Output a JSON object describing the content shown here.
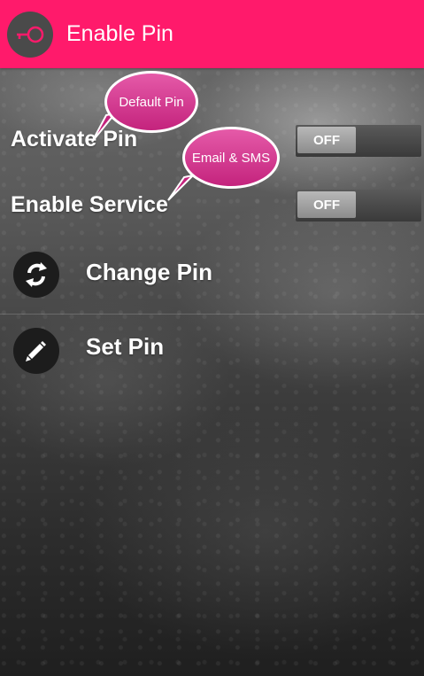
{
  "action_bar": {
    "title": "Enable Pin",
    "icon": "key-icon",
    "color": "#ff1a6b"
  },
  "settings": [
    {
      "label": "Activate Pin",
      "toggle_state": "OFF",
      "tooltip": "Default Pin"
    },
    {
      "label": "Enable Service",
      "toggle_state": "OFF",
      "tooltip": "Email & SMS"
    }
  ],
  "menu": [
    {
      "label": "Change Pin",
      "icon": "refresh-icon"
    },
    {
      "label": "Set Pin",
      "icon": "pencil-icon"
    }
  ]
}
